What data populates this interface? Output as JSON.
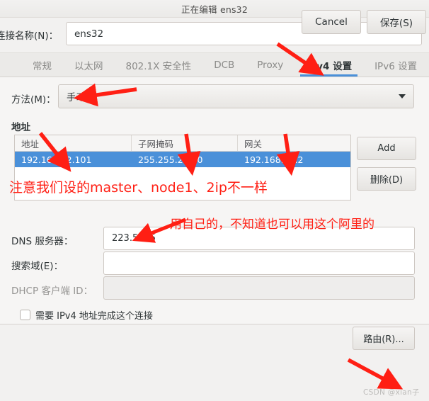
{
  "window": {
    "title": "正在编辑 ens32"
  },
  "connection": {
    "label": "连接名称(N)：",
    "value": "ens32",
    "placeholder": ""
  },
  "tabs": [
    {
      "label": "常规",
      "active": false
    },
    {
      "label": "以太网",
      "active": false
    },
    {
      "label": "802.1X 安全性",
      "active": false
    },
    {
      "label": "DCB",
      "active": false
    },
    {
      "label": "Proxy",
      "active": false
    },
    {
      "label": "IPv4 设置",
      "active": true
    },
    {
      "label": "IPv6 设置",
      "active": false
    }
  ],
  "ipv4": {
    "method": {
      "label": "方法(M)：",
      "value": "手动"
    },
    "addresses": {
      "heading": "地址",
      "columns": [
        "地址",
        "子网掩码",
        "网关"
      ],
      "rows": [
        {
          "address": "192.168.12.101",
          "netmask": "255.255.255.0",
          "gateway": "192.168.12.2",
          "selected": true
        }
      ],
      "add_label": "Add",
      "delete_label": "删除(D)"
    },
    "dns": {
      "label": "DNS 服务器：",
      "value": "223.5.5.5",
      "placeholder": ""
    },
    "search_domains": {
      "label": "搜索域(E)：",
      "value": "",
      "placeholder": ""
    },
    "dhcp_client_id": {
      "label": "DHCP 客户端 ID：",
      "value": "",
      "placeholder": "",
      "disabled": true
    },
    "require_ipv4": {
      "label": "需要 IPv4 地址完成这个连接",
      "checked": false
    },
    "routes_label": "路由(R)..."
  },
  "footer": {
    "cancel_label": "Cancel",
    "save_label": "保存(S)"
  },
  "watermark": {
    "text": "CSDN @xian子"
  },
  "annotations": {
    "note_1": "注意我们设的master、node1、2ip不一样",
    "note_2": "用自己的，不知道也可以用这个阿里的"
  },
  "colors": {
    "accent": "#4a90d9",
    "annotation": "#ff1f14",
    "window_bg": "#f2f1f0",
    "content_bg": "#f6f5f4"
  }
}
